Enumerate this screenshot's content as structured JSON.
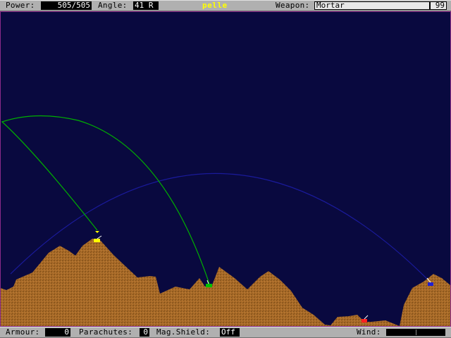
{
  "top_bar": {
    "power_label": "Power:",
    "power_value": "505/505",
    "angle_label": "Angle:",
    "angle_value": "41 R",
    "player_name": "pelle",
    "weapon_label": "Weapon:",
    "weapon_value": "Mortar",
    "weapon_count": "99"
  },
  "bottom_bar": {
    "armour_label": "Armour:",
    "armour_value": "0",
    "parachutes_label": "Parachutes:",
    "parachutes_value": "0",
    "mag_shield_label": "Mag.Shield:",
    "mag_shield_value": "Off",
    "wind_label": "Wind:",
    "wind_strength": 0.0
  },
  "battlefield": {
    "sky_color": "#09093f",
    "ground_color": "#a86a28",
    "border_color": "#8a2a8a",
    "tanks": [
      {
        "name": "yellow-tank",
        "color": "#ffff00",
        "active": true
      },
      {
        "name": "green-tank",
        "color": "#00c000",
        "active": false
      },
      {
        "name": "red-tank",
        "color": "#ff2020",
        "active": false
      },
      {
        "name": "blue-tank",
        "color": "#2020d0",
        "active": false
      }
    ],
    "trajectories": [
      {
        "name": "green-trajectory",
        "color": "#00b000"
      },
      {
        "name": "blue-trajectory",
        "color": "#1a1a9a"
      }
    ]
  }
}
